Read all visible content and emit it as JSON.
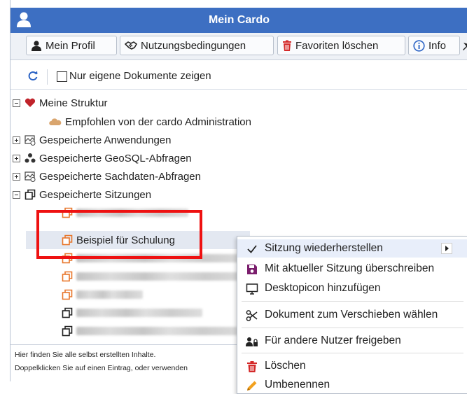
{
  "window": {
    "title": "Mein Cardo"
  },
  "toolbar": {
    "profile": "Mein Profil",
    "terms": "Nutzungsbedingungen",
    "clear_favorites": "Favoriten löschen",
    "info": "Info"
  },
  "filter": {
    "only_own_label": "Nur eigene Dokumente zeigen",
    "checked": false
  },
  "tree": {
    "meine_struktur": "Meine Struktur",
    "empfohlen": "Empfohlen von der cardo Administration",
    "anwendungen": "Gespeicherte Anwendungen",
    "geosql": "Gespeicherte GeoSQL-Abfragen",
    "sachdaten": "Gespeicherte Sachdaten-Abfragen",
    "sitzungen": "Gespeicherte Sitzungen",
    "selected_session": "Beispiel für Schulung"
  },
  "status": {
    "line1": "Hier finden Sie alle selbst erstellten Inhalte.",
    "line2": "Doppelklicken Sie auf einen Eintrag, oder verwenden"
  },
  "context_menu": {
    "restore": "Sitzung wiederherstellen",
    "overwrite": "Mit aktueller Sitzung überschreiben",
    "desktop_icon": "Desktopicon hinzufügen",
    "move": "Dokument zum Verschieben wählen",
    "share": "Für andere Nutzer freigeben",
    "delete": "Löschen",
    "rename": "Umbenennen"
  },
  "colors": {
    "titlebar": "#3d6fc2",
    "highlight": "#ee1111",
    "session_icon": "#e8762b"
  }
}
